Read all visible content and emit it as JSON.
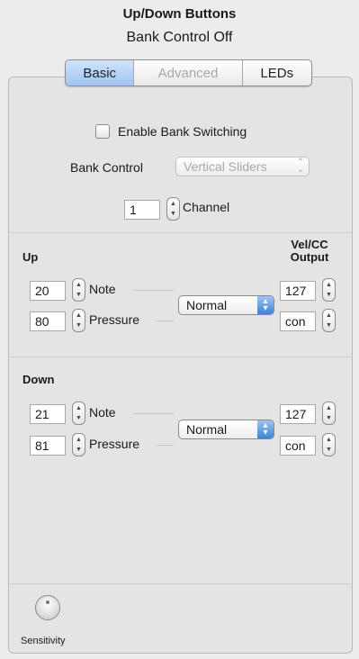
{
  "header": {
    "title": "Up/Down Buttons",
    "subtitle": "Bank Control Off"
  },
  "tabs": [
    {
      "label": "Basic",
      "state": "selected"
    },
    {
      "label": "Advanced",
      "state": "disabled"
    },
    {
      "label": "LEDs",
      "state": "normal"
    }
  ],
  "bank": {
    "enable_label": "Enable Bank Switching",
    "enable_checked": false,
    "control_label": "Bank Control",
    "control_value": "Vertical Sliders",
    "channel_value": "1",
    "channel_label": "Channel"
  },
  "output_header": {
    "line1": "Vel/CC",
    "line2": "Output"
  },
  "up": {
    "label": "Up",
    "note_value": "20",
    "note_label": "Note",
    "pressure_value": "80",
    "pressure_label": "Pressure",
    "mode_value": "Normal",
    "vel_value": "127",
    "output_value": "con"
  },
  "down": {
    "label": "Down",
    "note_value": "21",
    "note_label": "Note",
    "pressure_value": "81",
    "pressure_label": "Pressure",
    "mode_value": "Normal",
    "vel_value": "127",
    "output_value": "con"
  },
  "sensitivity": {
    "label": "Sensitivity"
  },
  "colors": {
    "accent": "#3e83d9",
    "tab_selected": "#9fc5f3",
    "background": "#ececec"
  }
}
